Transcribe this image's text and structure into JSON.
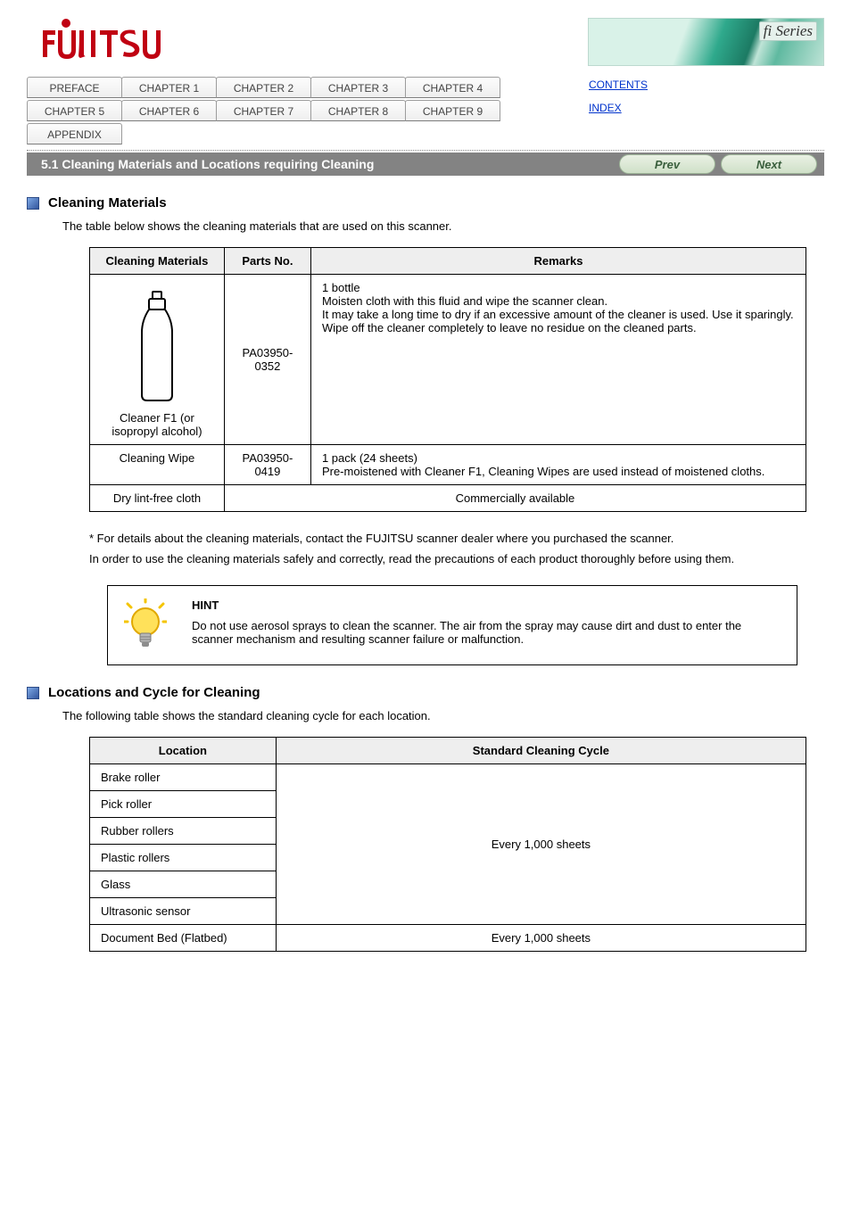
{
  "header": {
    "logo_alt": "FUJITSU",
    "banner_label": "fi Series"
  },
  "tabs": [
    "PREFACE",
    "CHAPTER 1",
    "CHAPTER 2",
    "CHAPTER 3",
    "CHAPTER 4",
    "CHAPTER 5",
    "CHAPTER 6",
    "CHAPTER 7",
    "CHAPTER 8",
    "CHAPTER 9",
    "APPENDIX"
  ],
  "sidelinks": {
    "contents": "CONTENTS",
    "index": "INDEX"
  },
  "title_bar": "5.1 Cleaning Materials and Locations requiring Cleaning",
  "nav": {
    "prev": "Prev",
    "next": "Next"
  },
  "section1": {
    "heading": "Cleaning Materials",
    "intro": "The table below shows the cleaning materials that are used on this scanner.",
    "table": {
      "head": [
        "Cleaning Materials",
        "Parts No.",
        "Remarks"
      ],
      "row1_c1": "Cleaner F1 (or isopropyl alcohol)",
      "row1_c2": "PA03950-0352",
      "row1_c3": "1 bottle\nMoisten cloth with this fluid and wipe the scanner clean.\nIt may take a long time to dry if an excessive amount of the cleaner is used. Use it sparingly. Wipe off the cleaner completely to leave no residue on the cleaned parts.",
      "row2_c1": "Cleaning Wipe",
      "row2_c2": "PA03950-0419",
      "row2_c3": "1 pack (24 sheets)\nPre-moistened with Cleaner F1, Cleaning Wipes are used instead of moistened cloths.",
      "row3_c1": "Dry lint-free cloth",
      "row3_c3": "Commercially available"
    },
    "asterisk": "* For details about the cleaning materials, contact the FUJITSU scanner dealer where you purchased the scanner.",
    "below_note": "In order to use the cleaning materials safely and correctly, read the precautions of each product thoroughly before using them.",
    "hint_title": "HINT",
    "hint_body": "Do not use aerosol sprays to clean the scanner. The air from the spray may cause dirt and dust to enter the scanner mechanism and resulting scanner failure or malfunction."
  },
  "section2": {
    "heading": "Locations and Cycle for Cleaning",
    "intro": "The following table shows the standard cleaning cycle for each location.",
    "table": {
      "head": [
        "Location",
        "Standard Cleaning Cycle"
      ],
      "rows_left": [
        "Brake roller",
        "Pick roller",
        "Rubber rollers",
        "Plastic rollers",
        "Glass",
        "Ultrasonic sensor",
        "Document Bed (Flatbed)"
      ],
      "right_main": "Every 1,000 sheets",
      "right_last": "Every 1,000 sheets"
    }
  }
}
